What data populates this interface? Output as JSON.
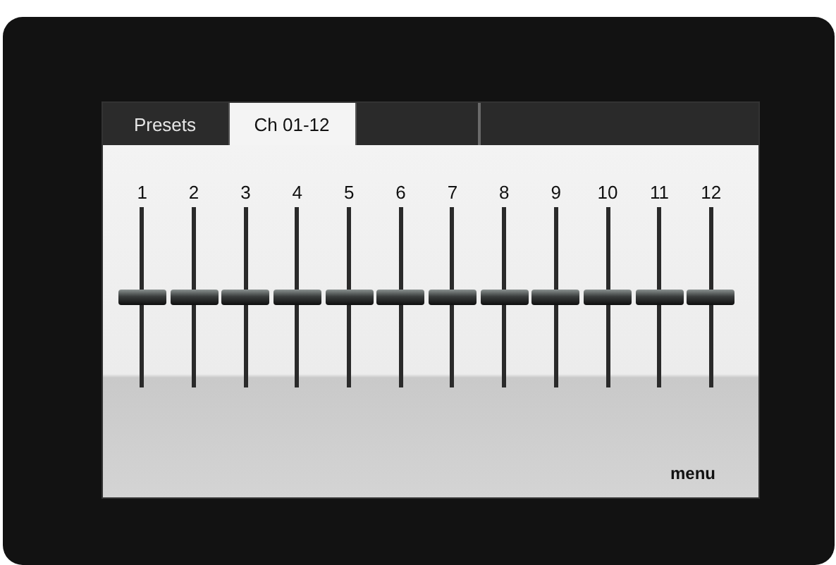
{
  "tabs": [
    {
      "label": "Presets",
      "selected": false
    },
    {
      "label": "Ch 01-12",
      "selected": true
    }
  ],
  "faders": [
    {
      "label": "1",
      "level": 0.5
    },
    {
      "label": "2",
      "level": 0.5
    },
    {
      "label": "3",
      "level": 0.5
    },
    {
      "label": "4",
      "level": 0.5
    },
    {
      "label": "5",
      "level": 0.5
    },
    {
      "label": "6",
      "level": 0.5
    },
    {
      "label": "7",
      "level": 0.5
    },
    {
      "label": "8",
      "level": 0.5
    },
    {
      "label": "9",
      "level": 0.5
    },
    {
      "label": "10",
      "level": 0.5
    },
    {
      "label": "11",
      "level": 0.5
    },
    {
      "label": "12",
      "level": 0.5
    }
  ],
  "menu_button": "menu"
}
